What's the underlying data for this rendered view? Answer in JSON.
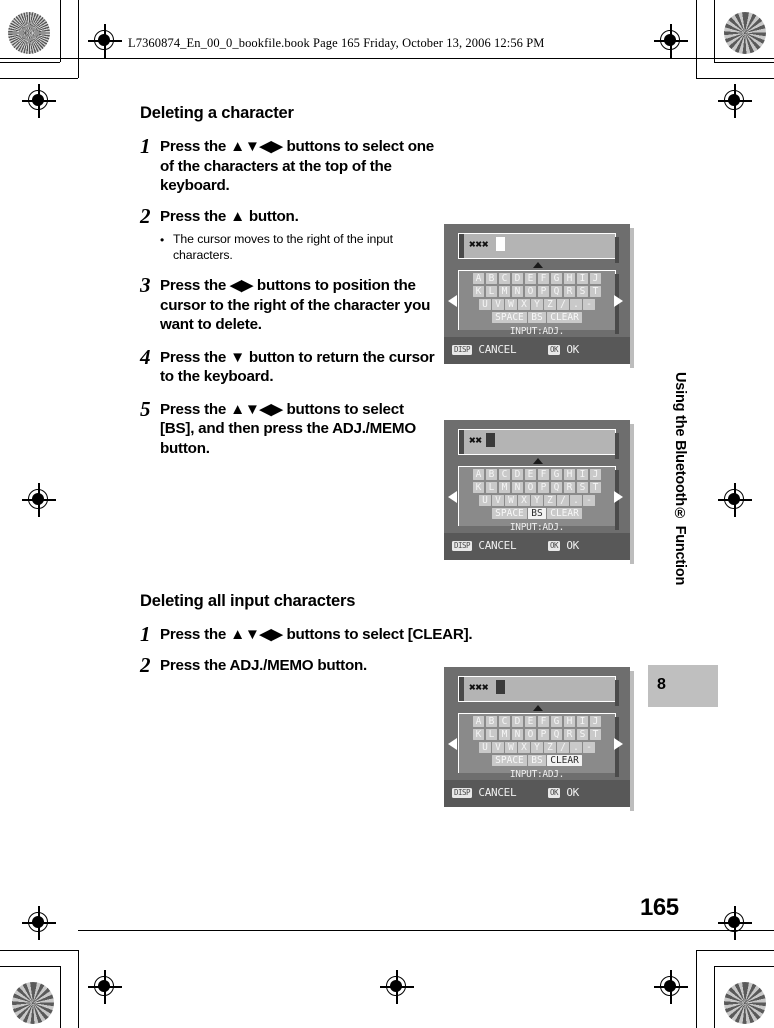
{
  "header": {
    "running_head": "L7360874_En_00_0_bookfile.book  Page 165  Friday, October 13, 2006  12:56 PM"
  },
  "sections": [
    {
      "heading": "Deleting a character",
      "steps": [
        {
          "num": "1",
          "text": "Press the ▲▼◀▶ buttons to select one of the characters at the top of the keyboard.",
          "bullet": null
        },
        {
          "num": "2",
          "text": "Press the ▲ button.",
          "bullet": "The cursor moves to the right of the input characters."
        },
        {
          "num": "3",
          "text": "Press the ◀▶ buttons to position the cursor to the right of the character you want to delete.",
          "bullet": null
        },
        {
          "num": "4",
          "text": "Press the ▼ button to return the cursor to the keyboard.",
          "bullet": null
        },
        {
          "num": "5",
          "text": "Press the ▲▼◀▶ buttons to select [BS], and then press the ADJ./MEMO button.",
          "bullet": null
        }
      ]
    },
    {
      "heading": "Deleting all input characters",
      "steps": [
        {
          "num": "1",
          "text": "Press the ▲▼◀▶ buttons to select [CLEAR].",
          "bullet": null
        },
        {
          "num": "2",
          "text": "Press the ADJ./MEMO button.",
          "bullet": null
        }
      ]
    }
  ],
  "keyboard": {
    "row1": [
      "A",
      "B",
      "C",
      "D",
      "E",
      "F",
      "G",
      "H",
      "I",
      "J"
    ],
    "row2": [
      "K",
      "L",
      "M",
      "N",
      "O",
      "P",
      "Q",
      "R",
      "S",
      "T"
    ],
    "row3": [
      "U",
      "V",
      "W",
      "X",
      "Y",
      "Z",
      "/",
      ".",
      "-"
    ],
    "row4": [
      "SPACE",
      "BS",
      "CLEAR"
    ],
    "hint": "INPUT:ADJ.",
    "cancel_badge": "DISP",
    "cancel_label": "CANCEL",
    "ok_badge": "OK",
    "ok_label": "OK"
  },
  "screens": [
    {
      "name": "screen-cursor-at-input",
      "field_value": "✖✖✖",
      "caret_style": "white",
      "selected_key": null
    },
    {
      "name": "screen-bs-selected",
      "field_value": "✖✖",
      "caret_style": "dark",
      "selected_key": "BS"
    },
    {
      "name": "screen-clear-selected",
      "field_value": "✖✖✖",
      "caret_style": "dark",
      "selected_key": "CLEAR"
    }
  ],
  "margin": {
    "chapter_title": "Using the Bluetooth® Function",
    "chapter_number": "8",
    "page_number": "165"
  },
  "colors": {
    "lcd_body": "#6e6e6e",
    "lcd_bottom": "#585858",
    "key_face": "#c9c9c9",
    "key_selected": "#f2f2f2",
    "tab_gray": "#bfbfbf"
  }
}
